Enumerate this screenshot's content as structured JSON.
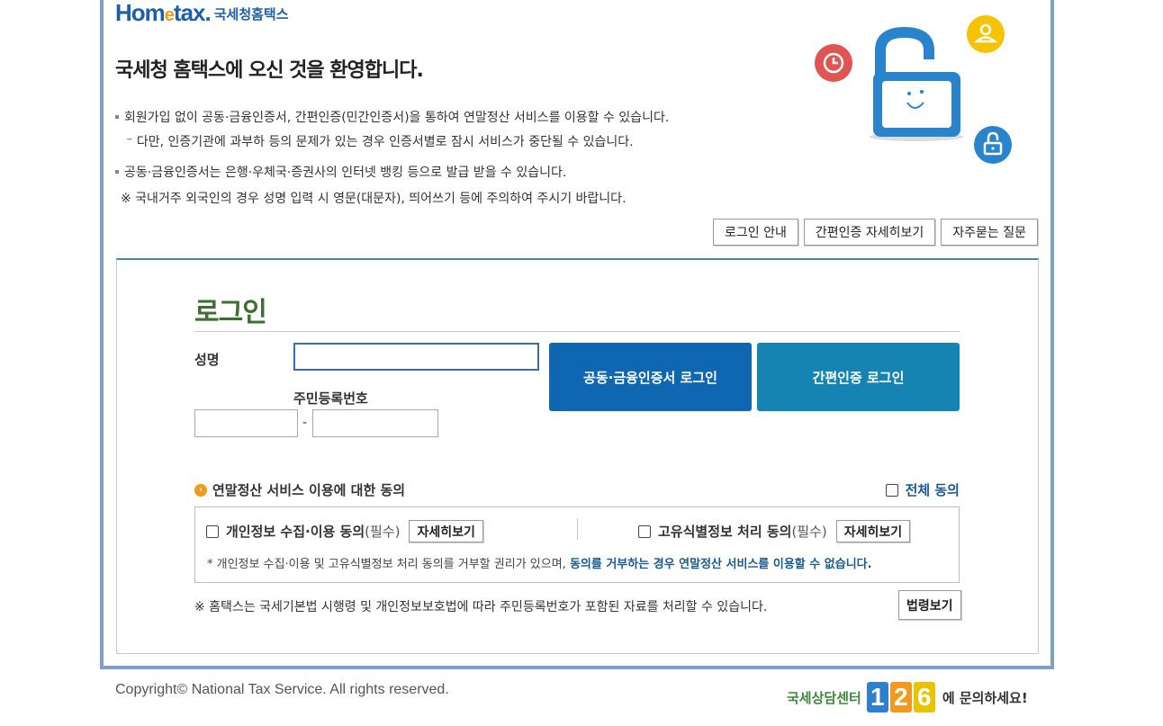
{
  "header": {
    "logo_main": "Hom",
    "logo_e": "e",
    "logo_rest": "tax.",
    "logo_sub": "국세청홈택스",
    "welcome": "국세청 홈택스에 오신 것을 환영합니다."
  },
  "notices": [
    "회원가입 없이 공동·금융인증서, 간편인증(민간인증서)을 통하여 연말정산 서비스를 이용할 수 있습니다.",
    "⁻ 다만, 인증기관에 과부하 등의 문제가 있는 경우 인증서별로 잠시 서비스가 중단될 수 있습니다.",
    "공동·금융인증서는 은행·우체국·증권사의 인터넷 뱅킹 등으로 발급 받을 수 있습니다.",
    "※ 국내거주 외국인의 경우 성명 입력 시 영문(대문자), 띄어쓰기 등에 주의하여 주시기 바랍니다."
  ],
  "top_buttons": {
    "login_guide": "로그인 안내",
    "simple_auth_detail": "간편인증 자세히보기",
    "faq": "자주묻는 질문"
  },
  "login": {
    "title": "로그인",
    "name_label": "성명",
    "name_value": "",
    "rrn_label": "주민등록번호",
    "rrn_front_value": "",
    "rrn_back_value": "",
    "rrn_dash": "-",
    "cert_login": "공동·금융인증서 로그인",
    "simple_login": "간편인증 로그인"
  },
  "consent": {
    "heading": "연말정산 서비스 이용에 대한 동의",
    "all_agree": "전체 동의",
    "privacy_label": "개인정보 수집·이용 동의",
    "unique_id_label": "고유식별정보 처리 동의",
    "required": "(필수)",
    "detail_button": "자세히보기",
    "note_plain": "* 개인정보 수집·이용 및 고유식별정보 처리 동의를 거부할 권리가 있으며, ",
    "note_bold": "동의를 거부하는 경우 연말정산 서비스를 이용할 수 없습니다."
  },
  "law": {
    "note": "※ 홈택스는 국세기본법 시행령 및 개인정보보호법에 따라 주민등록번호가 포함된 자료를 처리할 수 있습니다.",
    "button": "법령보기"
  },
  "footer": {
    "copyright": "Copyright© National Tax Service. All rights reserved.",
    "callcenter_label": "국세상담센터",
    "callcenter_digits": [
      "1",
      "2",
      "6"
    ],
    "callcenter_suffix": "에 문의하세요!"
  },
  "colors": {
    "brand_blue": "#1b5faa",
    "cert_button": "#0f67b1",
    "simple_button": "#1584b3",
    "login_title_green": "#3d6e33",
    "accent_orange": "#f29a1b"
  }
}
